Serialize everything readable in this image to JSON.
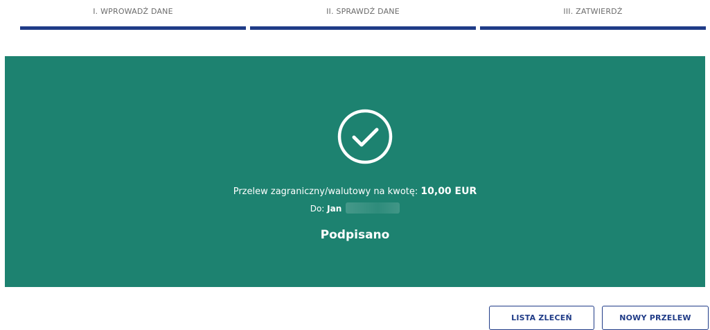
{
  "stepper": {
    "steps": [
      {
        "label": "I. WPROWADŹ DANE"
      },
      {
        "label": "II. SPRAWDŹ DANE"
      },
      {
        "label": "III. ZATWIERDŹ"
      }
    ]
  },
  "confirmation": {
    "icon": "check-circle-icon",
    "description_prefix": "Przelew zagraniczny/walutowy na kwotę:",
    "amount": "10,00 EUR",
    "recipient_label": "Do:",
    "recipient_name": "Jan",
    "status": "Podpisano"
  },
  "actions": {
    "lista_label": "LISTA ZLECEŃ",
    "nowy_label": "NOWY PRZELEW"
  },
  "colors": {
    "panel": "#1d8270",
    "accent": "#1f3b87",
    "text_light": "#ffffff"
  }
}
